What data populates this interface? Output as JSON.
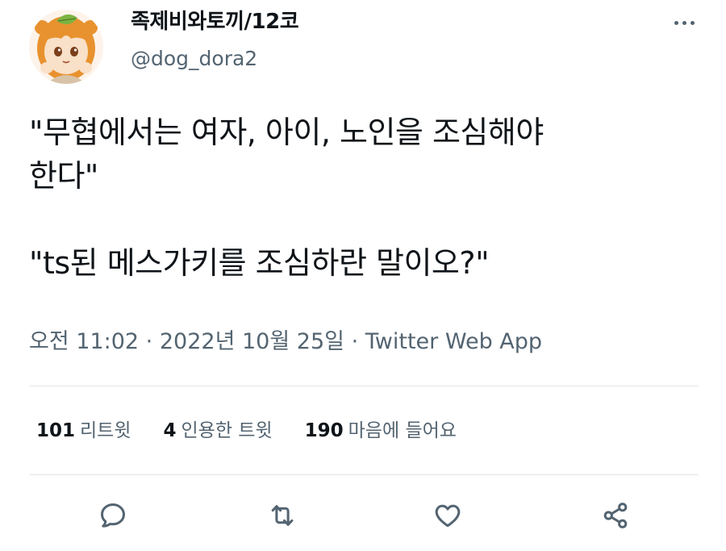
{
  "user": {
    "display_name": "족제비와토끼/12코",
    "handle": "@dog_dora2"
  },
  "tweet": {
    "lines": [
      "\"무협에서는 여자, 아이, 노인을 조심해야",
      "한다\"",
      "\"ts된 메스가키를 조심하란 말이오?\""
    ],
    "time": "오전 11:02",
    "separator": "·",
    "date": "2022년 10월 25일",
    "source": "Twitter Web App"
  },
  "stats": {
    "retweets": {
      "count": "101",
      "label": "리트윗"
    },
    "quotes": {
      "count": "4",
      "label": "인용한 트윗"
    },
    "likes": {
      "count": "190",
      "label": "마음에 들어요"
    }
  },
  "icons": {
    "more": "more-horizontal-icon",
    "reply": "reply-icon",
    "retweet": "retweet-icon",
    "like": "heart-icon",
    "share": "share-icon"
  },
  "colors": {
    "text": "#0f1419",
    "secondary": "#536471",
    "divider": "#e2e6e9",
    "icon": "#536471"
  }
}
